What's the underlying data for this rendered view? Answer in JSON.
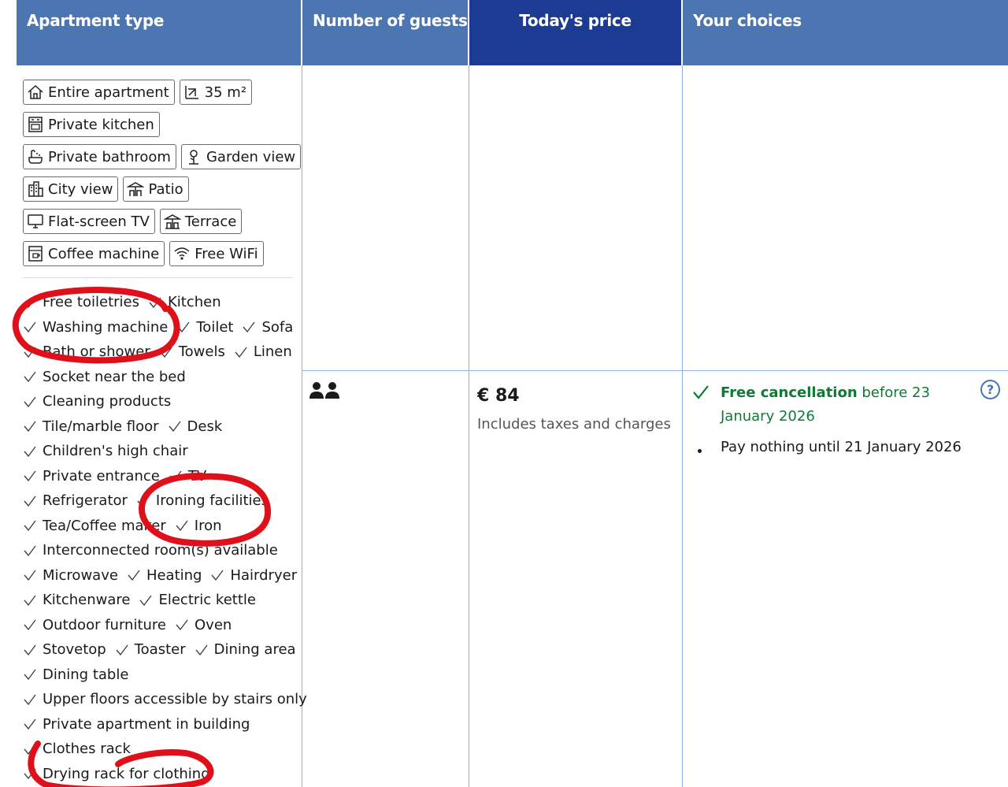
{
  "header": {
    "apartment_type": "Apartment type",
    "number_of_guests": "Number of guests",
    "todays_price": "Today's price",
    "your_choices": "Your choices"
  },
  "facility_chips": [
    [
      {
        "icon": "house-icon",
        "label": "Entire apartment"
      },
      {
        "icon": "floor-area-icon",
        "label": "35 m²"
      }
    ],
    [
      {
        "icon": "kitchen-icon",
        "label": "Private kitchen"
      }
    ],
    [
      {
        "icon": "bath-icon",
        "label": "Private bathroom"
      },
      {
        "icon": "garden-icon",
        "label": "Garden view"
      }
    ],
    [
      {
        "icon": "city-icon",
        "label": "City view"
      },
      {
        "icon": "patio-icon",
        "label": "Patio"
      }
    ],
    [
      {
        "icon": "tv-icon",
        "label": "Flat-screen TV"
      },
      {
        "icon": "terrace-icon",
        "label": "Terrace"
      }
    ],
    [
      {
        "icon": "coffee-machine-icon",
        "label": "Coffee machine"
      },
      {
        "icon": "wifi-icon",
        "label": "Free WiFi"
      }
    ]
  ],
  "amenity_lines": [
    [
      "Free toiletries",
      "Kitchen"
    ],
    [
      "Washing machine",
      "Toilet",
      "Sofa"
    ],
    [
      "Bath or shower",
      "Towels",
      "Linen"
    ],
    [
      "Socket near the bed"
    ],
    [
      "Cleaning products"
    ],
    [
      "Tile/marble floor",
      "Desk"
    ],
    [
      "Children's high chair"
    ],
    [
      "Private entrance",
      "TV"
    ],
    [
      "Refrigerator",
      "Ironing facilities"
    ],
    [
      "Tea/Coffee maker",
      "Iron"
    ],
    [
      "Interconnected room(s) available"
    ],
    [
      "Microwave",
      "Heating",
      "Hairdryer"
    ],
    [
      "Kitchenware",
      "Electric kettle"
    ],
    [
      "Outdoor furniture",
      "Oven"
    ],
    [
      "Stovetop",
      "Toaster",
      "Dining area"
    ],
    [
      "Dining table"
    ],
    [
      "Upper floors accessible by stairs only"
    ],
    [
      "Private apartment in building"
    ],
    [
      "Clothes rack"
    ],
    [
      "Drying rack for clothing"
    ]
  ],
  "guests": {
    "icon": "two-guests-icon",
    "count": 2
  },
  "price": {
    "amount": "€ 84",
    "note": "Includes taxes and charges"
  },
  "choices": {
    "free_cancellation": "Free cancellation",
    "before_date": " before 23 January 2026",
    "pay_nothing": "Pay nothing until 21 January 2026",
    "help_icon": "question-circle-icon"
  },
  "colors": {
    "header_light": "#4c76b2",
    "header_dark": "#1c3c93",
    "cancellation_green": "#0f7a34",
    "annotation_red": "#e0101a"
  }
}
